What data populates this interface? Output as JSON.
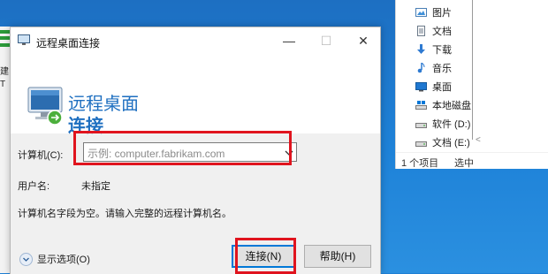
{
  "explorer": {
    "nav_items": [
      {
        "label": "图片",
        "icon": "pictures-icon"
      },
      {
        "label": "文档",
        "icon": "documents-icon"
      },
      {
        "label": "下载",
        "icon": "downloads-icon"
      },
      {
        "label": "音乐",
        "icon": "music-icon"
      },
      {
        "label": "桌面",
        "icon": "desktop-folder-icon"
      },
      {
        "label": "本地磁盘",
        "icon": "drive-icon"
      },
      {
        "label": "软件 (D:)",
        "icon": "drive-icon"
      },
      {
        "label": "文档 (E:)",
        "icon": "drive-icon"
      }
    ],
    "status_count": "1 个项目",
    "status_selected": "选中"
  },
  "left_strip": {
    "text1": "建",
    "text2": "T"
  },
  "dialog": {
    "title": "远程桌面连接",
    "controls": {
      "minimize": "—",
      "maximize": "☐",
      "close": "✕"
    },
    "banner_line1": "远程桌面",
    "banner_line2": "连接",
    "computer_label": "计算机(C):",
    "computer_placeholder": "示例: computer.fabrikam.com",
    "username_label": "用户名:",
    "username_value": "未指定",
    "message": "计算机名字段为空。请输入完整的远程计算机名。",
    "show_options": "显示选项(O)",
    "connect_button": "连接(N)",
    "help_button": "帮助(H)"
  },
  "colors": {
    "accent": "#1e6fc0",
    "highlight": "#e0141e",
    "focus": "#0078d7"
  }
}
